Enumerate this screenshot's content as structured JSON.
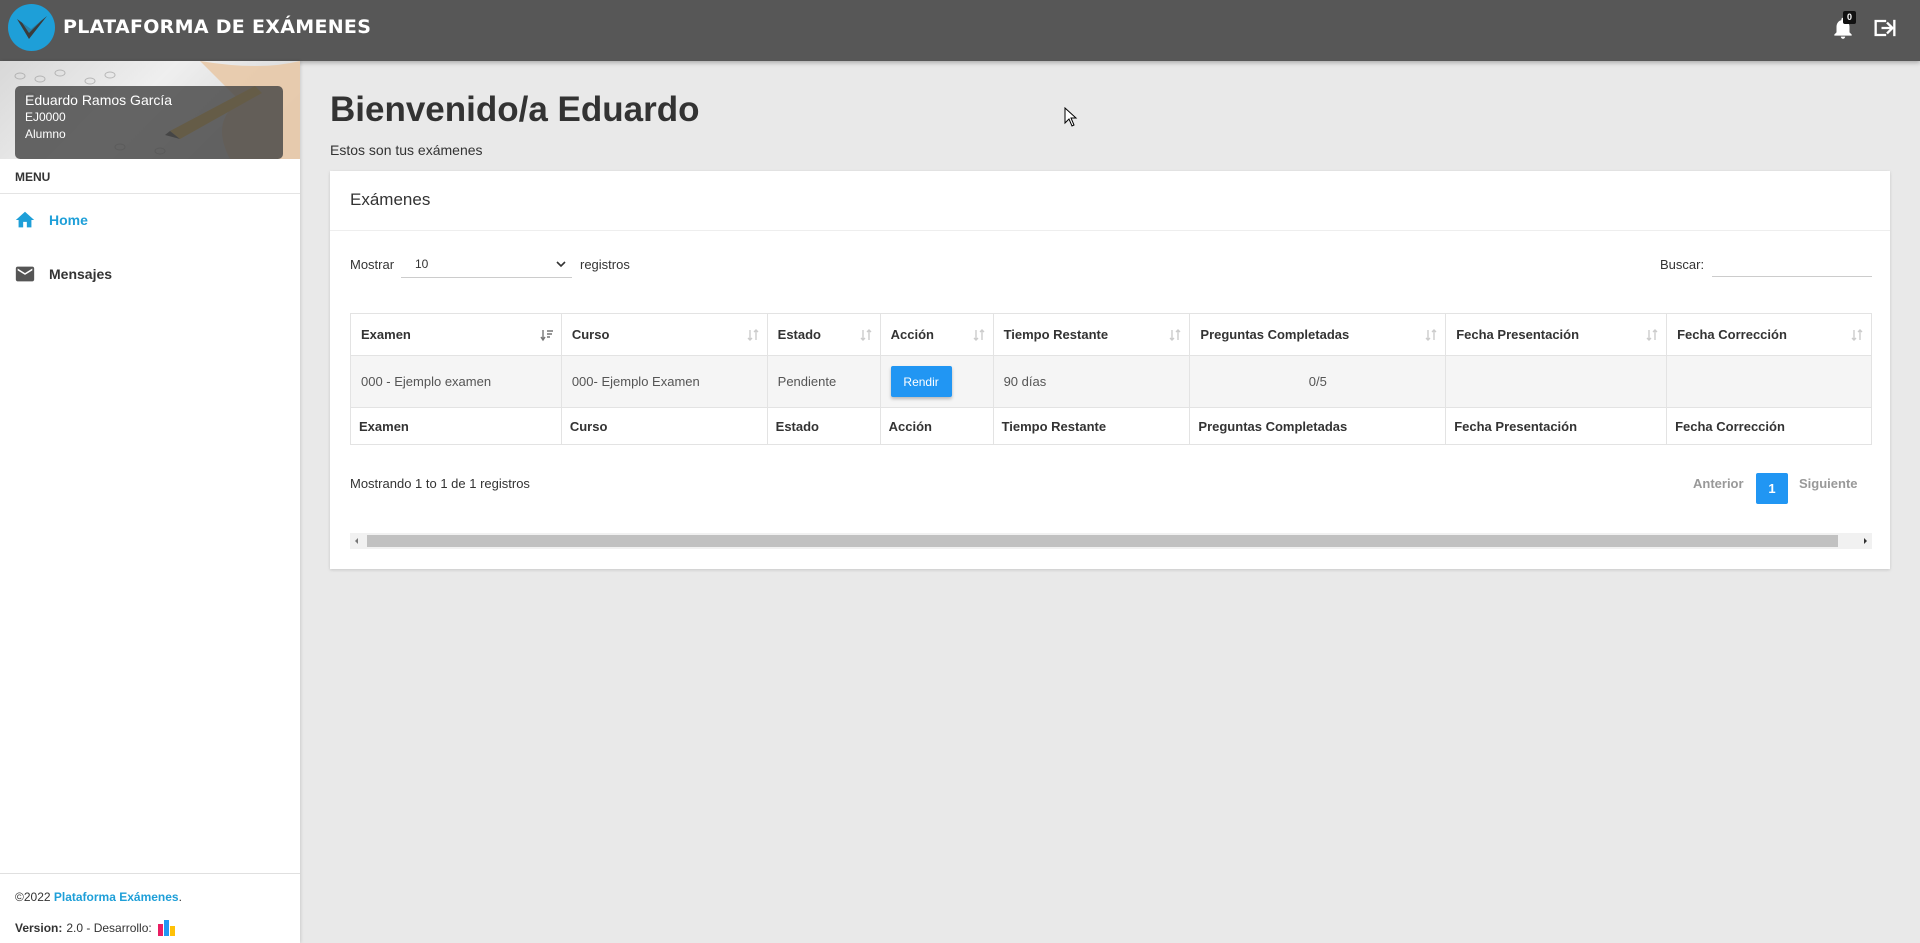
{
  "brand": {
    "name": "PLATAFORMA DE EXÁMENES",
    "accent": "#1e9fd8",
    "logo_icon": "checkmark-logo-icon"
  },
  "topbar": {
    "notification_count": "0",
    "bell_icon": "bell-icon",
    "logout_icon": "logout-icon"
  },
  "user": {
    "name": "Eduardo Ramos García",
    "code": "EJ0000",
    "role": "Alumno"
  },
  "sidebar": {
    "menu_label": "MENU",
    "items": [
      {
        "label": "Home",
        "icon": "home-icon",
        "active": true
      },
      {
        "label": "Mensajes",
        "icon": "mail-icon",
        "active": false
      }
    ],
    "footer": {
      "copyright_prefix": "©2022 ",
      "copyright_link": "Plataforma Exámenes",
      "copyright_suffix": ".",
      "version_label": "Version:",
      "version_value": " 2.0 - Desarrollo: "
    }
  },
  "main": {
    "title": "Bienvenido/a Eduardo",
    "subtitle": "Estos son tus exámenes"
  },
  "card": {
    "title": "Exámenes",
    "length": {
      "prefix": "Mostrar",
      "value": "10",
      "suffix": "registros"
    },
    "search_label": "Buscar:",
    "search_value": "",
    "columns": [
      "Examen",
      "Curso",
      "Estado",
      "Acción",
      "Tiempo Restante",
      "Preguntas Completadas",
      "Fecha Presentación",
      "Fecha Corrección"
    ],
    "rows": [
      {
        "examen": "000 - Ejemplo examen",
        "curso": "000- Ejemplo Examen",
        "estado": "Pendiente",
        "accion": "Rendir",
        "tiempo": "90 días",
        "preguntas": "0/5",
        "fecha_presentacion": "",
        "fecha_correccion": ""
      }
    ],
    "info": "Mostrando 1 to 1 de 1 registros",
    "pagination": {
      "prev": "Anterior",
      "current": "1",
      "next": "Siguiente"
    }
  }
}
